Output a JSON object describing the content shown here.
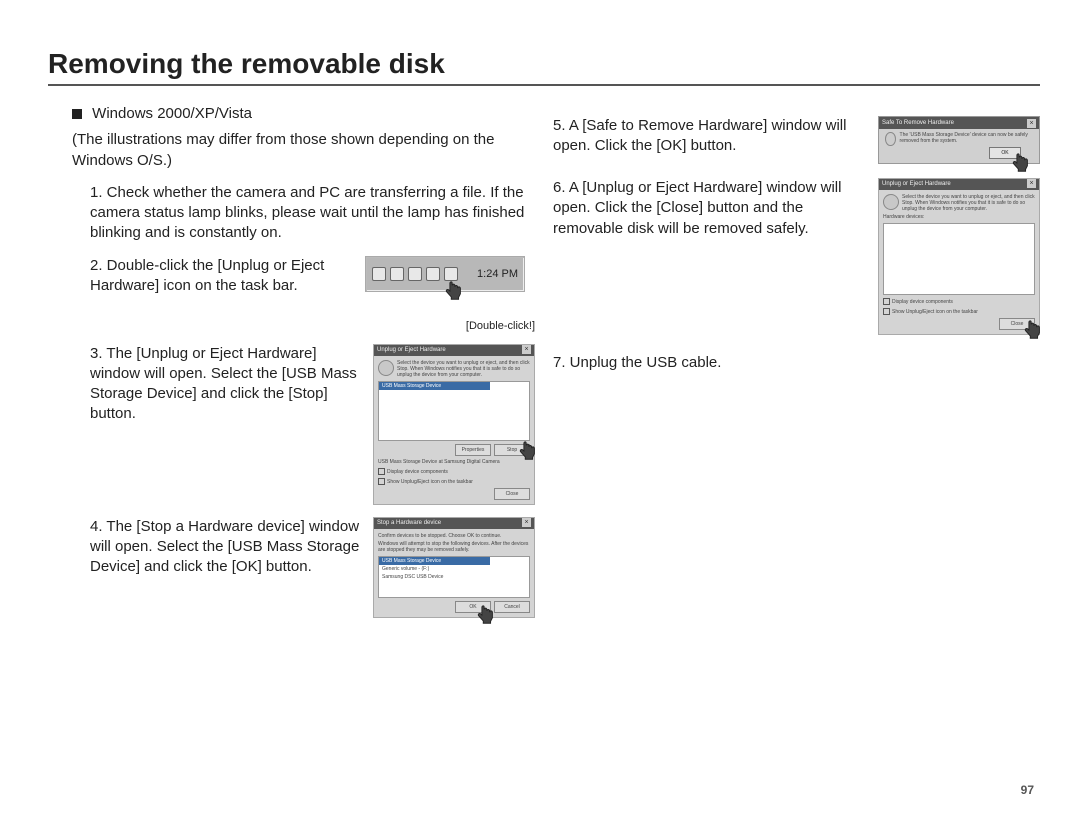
{
  "title": "Removing the removable disk",
  "page_number": "97",
  "left": {
    "header_marker": "■",
    "header": "Windows 2000/XP/Vista",
    "header_note": "(The illustrations may differ from those shown depending on the Windows O/S.)",
    "step1": "1. Check whether the camera and PC are transferring a file. If the camera status lamp blinks, please wait until the lamp has finished blinking and is constantly on.",
    "step2": "2. Double-click the [Unplug or Eject Hardware] icon on the task bar.",
    "step2_fig": {
      "time": "1:24 PM",
      "label": "[Double-click!]"
    },
    "step3": "3. The [Unplug or Eject Hardware] window will open. Select the [USB Mass Storage Device] and click the [Stop] button.",
    "step3_dlg": {
      "title": "Unplug or Eject Hardware",
      "text": "Select the device you want to unplug or eject, and then click Stop. When Windows notifies you that it is safe to do so unplug the device from your computer.",
      "item": "USB Mass Storage Device",
      "btn_props": "Properties",
      "btn_stop": "Stop",
      "footer": "USB Mass Storage Device at Samsung Digital Camera",
      "chk1": "Display device components",
      "chk2": "Show Unplug/Eject icon on the taskbar",
      "btn_close": "Close"
    },
    "step4": "4. The [Stop a Hardware device] window will open. Select the [USB Mass Storage Device] and click the [OK] button.",
    "step4_dlg": {
      "title": "Stop a Hardware device",
      "text1": "Confirm devices to be stopped. Choose OK to continue.",
      "text2": "Windows will attempt to stop the following devices. After the devices are stopped they may be removed safely.",
      "item1": "USB Mass Storage Device",
      "item2": "Generic volume - (F:)",
      "item3": "Samsung DSC USB Device",
      "btn_ok": "OK",
      "btn_cancel": "Cancel"
    }
  },
  "right": {
    "step5": "5. A [Safe to Remove Hardware] window will open. Click the [OK] button.",
    "step5_dlg": {
      "title": "Safe To Remove Hardware",
      "text": "The 'USB Mass Storage Device' device can now be safely removed from the system.",
      "btn_ok": "OK"
    },
    "step6": "6. A [Unplug or Eject Hardware] window will open. Click the [Close] button and the removable disk will be removed safely.",
    "step6_dlg": {
      "title": "Unplug or Eject Hardware",
      "text": "Select the device you want to unplug or eject, and then click Stop. When Windows notifies you that it is safe to do so unplug the device from your computer.",
      "label": "Hardware devices:",
      "chk1": "Display device components",
      "chk2": "Show Unplug/Eject icon on the taskbar",
      "btn_close": "Close"
    },
    "step7": "7. Unplug the USB cable."
  }
}
